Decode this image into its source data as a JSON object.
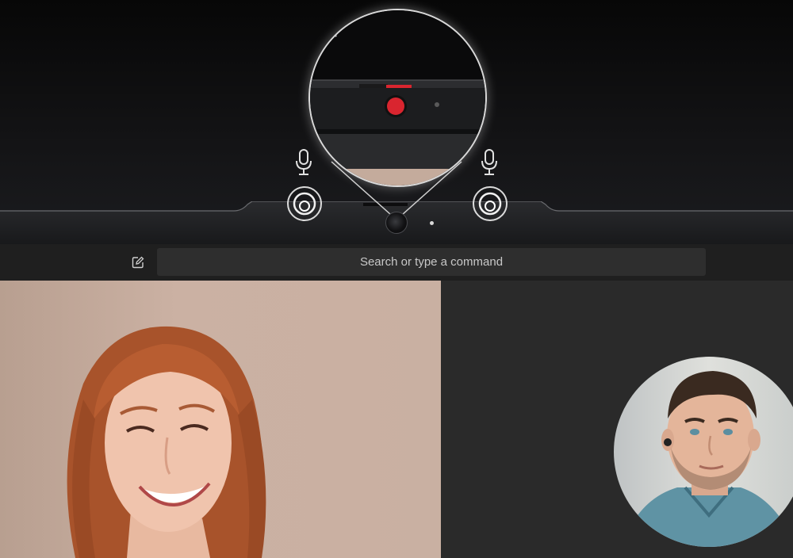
{
  "toolbar": {
    "search_placeholder": "Search or type a command",
    "compose_icon": "compose-icon"
  },
  "hardware": {
    "privacy_icon": "eye-slash-icon",
    "shutter_color": "#d9252f",
    "mic_icon": "microphone-icon"
  },
  "colors": {
    "bezel": "#141416",
    "toolbar": "#1f1f1f",
    "search_bg": "#2e2e2e",
    "video_bg": "#2a2a2a"
  }
}
